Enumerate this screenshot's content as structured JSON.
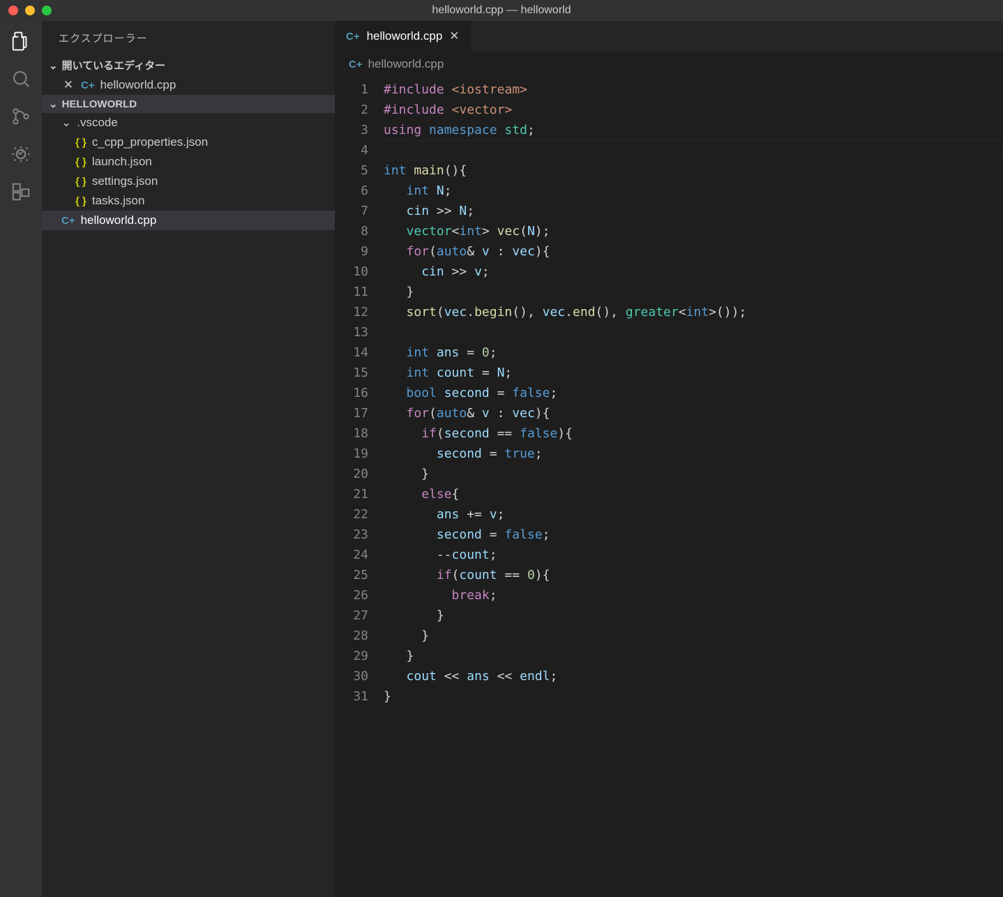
{
  "window_title": "helloworld.cpp — helloworld",
  "sidebar": {
    "explorer_title": "エクスプローラー",
    "open_editors_label": "開いているエディター",
    "open_file": "helloworld.cpp",
    "folder_name": "HELLOWORLD",
    "vscode_folder": ".vscode",
    "files_vscode": [
      "c_cpp_properties.json",
      "launch.json",
      "settings.json",
      "tasks.json"
    ],
    "root_file": "helloworld.cpp"
  },
  "tab": {
    "name": "helloworld.cpp"
  },
  "breadcrumb": "helloworld.cpp",
  "code": {
    "line_count": 31,
    "lines": [
      {
        "n": 1,
        "html": "<span class='c'>#include</span> <span class='s'>&lt;iostream&gt;</span>"
      },
      {
        "n": 2,
        "html": "<span class='c'>#include</span> <span class='s'>&lt;vector&gt;</span>"
      },
      {
        "n": 3,
        "html": "<span class='c'>using</span> <span class='k'>namespace</span> <span class='t'>std</span>;"
      },
      {
        "n": 4,
        "html": ""
      },
      {
        "n": 5,
        "html": "<span class='k'>int</span> <span class='f'>main</span>(){"
      },
      {
        "n": 6,
        "html": "   <span class='k'>int</span> <span class='v'>N</span>;"
      },
      {
        "n": 7,
        "html": "   <span class='v'>cin</span> &gt;&gt; <span class='v'>N</span>;"
      },
      {
        "n": 8,
        "html": "   <span class='t'>vector</span>&lt;<span class='k'>int</span>&gt; <span class='f'>vec</span>(<span class='v'>N</span>);"
      },
      {
        "n": 9,
        "html": "   <span class='c'>for</span>(<span class='k'>auto</span>&amp; <span class='v'>v</span> : <span class='v'>vec</span>){"
      },
      {
        "n": 10,
        "html": "     <span class='v'>cin</span> &gt;&gt; <span class='v'>v</span>;"
      },
      {
        "n": 11,
        "html": "   }"
      },
      {
        "n": 12,
        "html": "   <span class='f'>sort</span>(<span class='v'>vec</span>.<span class='f'>begin</span>(), <span class='v'>vec</span>.<span class='f'>end</span>(), <span class='t'>greater</span>&lt;<span class='k'>int</span>&gt;());"
      },
      {
        "n": 13,
        "html": ""
      },
      {
        "n": 14,
        "html": "   <span class='k'>int</span> <span class='v'>ans</span> = <span class='n'>0</span>;"
      },
      {
        "n": 15,
        "html": "   <span class='k'>int</span> <span class='v'>count</span> = <span class='v'>N</span>;"
      },
      {
        "n": 16,
        "html": "   <span class='k'>bool</span> <span class='v'>second</span> = <span class='k'>false</span>;"
      },
      {
        "n": 17,
        "html": "   <span class='c'>for</span>(<span class='k'>auto</span>&amp; <span class='v'>v</span> : <span class='v'>vec</span>){"
      },
      {
        "n": 18,
        "html": "     <span class='c'>if</span>(<span class='v'>second</span> == <span class='k'>false</span>){"
      },
      {
        "n": 19,
        "html": "       <span class='v'>second</span> = <span class='k'>true</span>;"
      },
      {
        "n": 20,
        "html": "     }"
      },
      {
        "n": 21,
        "html": "     <span class='c'>else</span>{"
      },
      {
        "n": 22,
        "html": "       <span class='v'>ans</span> += <span class='v'>v</span>;"
      },
      {
        "n": 23,
        "html": "       <span class='v'>second</span> = <span class='k'>false</span>;"
      },
      {
        "n": 24,
        "html": "       --<span class='v'>count</span>;"
      },
      {
        "n": 25,
        "html": "       <span class='c'>if</span>(<span class='v'>count</span> == <span class='n'>0</span>){"
      },
      {
        "n": 26,
        "html": "         <span class='c'>break</span>;"
      },
      {
        "n": 27,
        "html": "       }"
      },
      {
        "n": 28,
        "html": "     }"
      },
      {
        "n": 29,
        "html": "   }"
      },
      {
        "n": 30,
        "html": "   <span class='v'>cout</span> &lt;&lt; <span class='v'>ans</span> &lt;&lt; <span class='v'>endl</span>;"
      },
      {
        "n": 31,
        "html": "}"
      }
    ]
  }
}
